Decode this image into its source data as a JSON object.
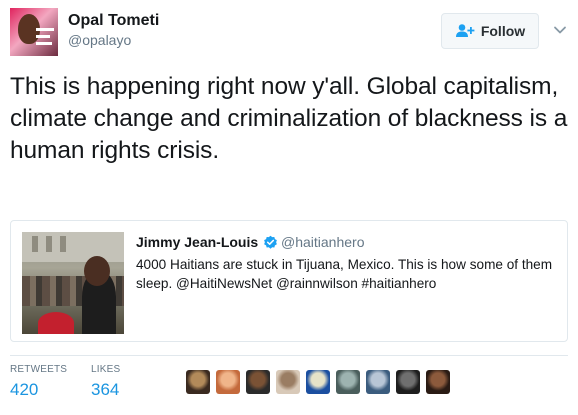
{
  "author": {
    "name": "Opal Tometi",
    "handle": "@opalayo"
  },
  "follow_button": {
    "label": "Follow",
    "icon": "person-add-icon"
  },
  "tweet": {
    "text": "This is happening right now y'all. Global capitalism, climate change and criminalization of blackness is a human rights crisis."
  },
  "quoted_tweet": {
    "name": "Jimmy Jean-Louis",
    "verified_icon": "verified-badge-icon",
    "handle": "@haitianhero",
    "text": "4000 Haitians are stuck in Tijuana, Mexico. This is how some of them sleep. @HaitiNewsNet @rainnwilson #haitianhero"
  },
  "stats": {
    "retweets_label": "RETWEETS",
    "retweets_value": "420",
    "likes_label": "LIKES",
    "likes_value": "364"
  },
  "colors": {
    "link_blue": "#1b95e0",
    "verified_blue": "#1da1f2",
    "secondary_text": "#657786",
    "border": "#e1e8ed"
  },
  "likers": [
    {
      "colors": [
        "#3a2a20",
        "#b28a5a"
      ]
    },
    {
      "colors": [
        "#c46a3c",
        "#f0b58a"
      ]
    },
    {
      "colors": [
        "#2b2b2b",
        "#7a5235"
      ]
    },
    {
      "colors": [
        "#d8c9b8",
        "#9a7d63"
      ]
    },
    {
      "colors": [
        "#1b4fa0",
        "#e6e2c8"
      ]
    },
    {
      "colors": [
        "#4a5e5c",
        "#9db3b0"
      ]
    },
    {
      "colors": [
        "#3b5c7e",
        "#b8c6d6"
      ]
    },
    {
      "colors": [
        "#1e1e1e",
        "#6f6f6f"
      ]
    },
    {
      "colors": [
        "#2a1b14",
        "#8c5a3c"
      ]
    }
  ]
}
